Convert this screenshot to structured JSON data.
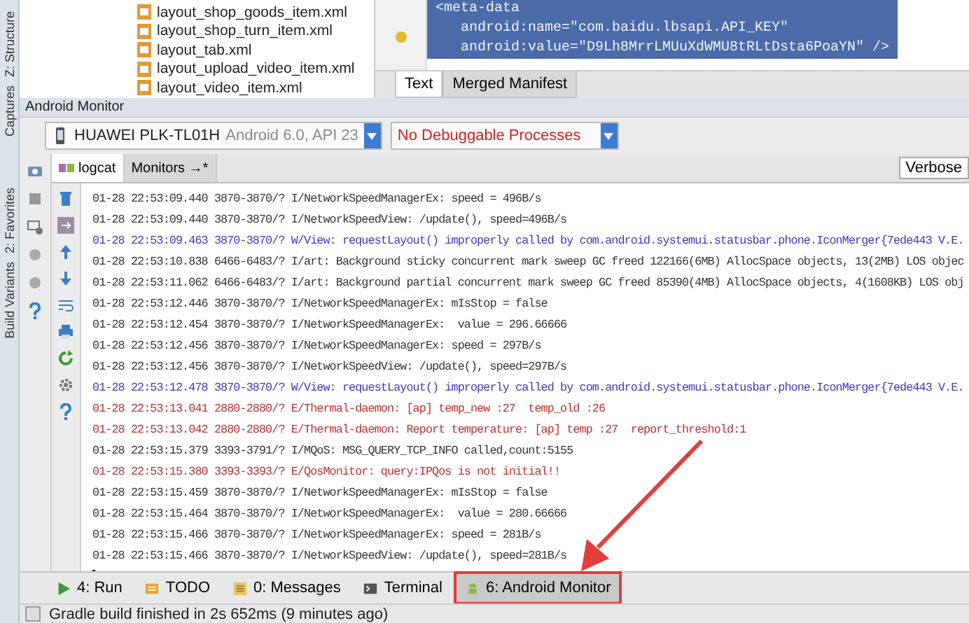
{
  "side_strip": {
    "labels": [
      "Z: Structure",
      "Captures",
      "2: Favorites",
      "Build Variants"
    ]
  },
  "project_tree": {
    "files": [
      "layout_shop_goods_item.xml",
      "layout_shop_turn_item.xml",
      "layout_tab.xml",
      "layout_upload_video_item.xml",
      "layout_video_item.xml"
    ]
  },
  "editor": {
    "lines": [
      {
        "text": "<meta-data",
        "selected": true
      },
      {
        "text": "android:name=\"com.baidu.lbsapi.API_KEY\"",
        "selected": true
      },
      {
        "text": "android:value=\"D9Lh8MrrLMUuXdWMU8tRLtDsta6PoaYN\" />",
        "selected": true
      }
    ],
    "tabs": [
      {
        "label": "Text",
        "selected": true
      },
      {
        "label": "Merged Manifest",
        "selected": false
      }
    ]
  },
  "monitor": {
    "title": "Android Monitor",
    "device": {
      "name": "HUAWEI PLK-TL01H",
      "detail": "Android 6.0, API 23"
    },
    "process": "No Debuggable Processes",
    "tabs": [
      {
        "label": "logcat",
        "selected": true
      },
      {
        "label": "Monitors →*",
        "selected": false
      }
    ],
    "log_level": "Verbose",
    "log": [
      {
        "kind": "I",
        "text": "01-28 22:53:09.440 3870-3870/? I/NetworkSpeedManagerEx: speed = 496B/s"
      },
      {
        "kind": "I",
        "text": "01-28 22:53:09.440 3870-3870/? I/NetworkSpeedView: /update(), speed=496B/s"
      },
      {
        "kind": "W",
        "text": "01-28 22:53:09.463 3870-3870/? W/View: requestLayout() improperly called by com.android.systemui.statusbar.phone.IconMerger{7ede443 V.E."
      },
      {
        "kind": "I",
        "text": "01-28 22:53:10.838 6466-6483/? I/art: Background sticky concurrent mark sweep GC freed 122166(6MB) AllocSpace objects, 13(2MB) LOS objec"
      },
      {
        "kind": "I",
        "text": "01-28 22:53:11.062 6466-6483/? I/art: Background partial concurrent mark sweep GC freed 85390(4MB) AllocSpace objects, 4(1608KB) LOS obj"
      },
      {
        "kind": "I",
        "text": "01-28 22:53:12.446 3870-3870/? I/NetworkSpeedManagerEx: mIsStop = false"
      },
      {
        "kind": "I",
        "text": "01-28 22:53:12.454 3870-3870/? I/NetworkSpeedManagerEx:  value = 296.66666"
      },
      {
        "kind": "I",
        "text": "01-28 22:53:12.456 3870-3870/? I/NetworkSpeedManagerEx: speed = 297B/s"
      },
      {
        "kind": "I",
        "text": "01-28 22:53:12.456 3870-3870/? I/NetworkSpeedView: /update(), speed=297B/s"
      },
      {
        "kind": "W",
        "text": "01-28 22:53:12.478 3870-3870/? W/View: requestLayout() improperly called by com.android.systemui.statusbar.phone.IconMerger{7ede443 V.E."
      },
      {
        "kind": "E",
        "text": "01-28 22:53:13.041 2880-2880/? E/Thermal-daemon: [ap] temp_new :27  temp_old :26"
      },
      {
        "kind": "E",
        "text": "01-28 22:53:13.042 2880-2880/? E/Thermal-daemon: Report temperature: [ap] temp :27  report_threshold:1"
      },
      {
        "kind": "I",
        "text": "01-28 22:53:15.379 3393-3791/? I/MQoS: MSG_QUERY_TCP_INFO called,count:5155"
      },
      {
        "kind": "E",
        "text": "01-28 22:53:15.380 3393-3393/? E/QosMonitor: query:IPQos is not initial!!"
      },
      {
        "kind": "I",
        "text": "01-28 22:53:15.459 3870-3870/? I/NetworkSpeedManagerEx: mIsStop = false"
      },
      {
        "kind": "I",
        "text": "01-28 22:53:15.464 3870-3870/? I/NetworkSpeedManagerEx:  value = 280.66666"
      },
      {
        "kind": "I",
        "text": "01-28 22:53:15.466 3870-3870/? I/NetworkSpeedManagerEx: speed = 281B/s"
      },
      {
        "kind": "I",
        "text": "01-28 22:53:15.466 3870-3870/? I/NetworkSpeedView: /update(), speed=281B/s"
      }
    ]
  },
  "tool_windows": [
    {
      "label": "4: Run",
      "kind": "run",
      "selected": false
    },
    {
      "label": "TODO",
      "kind": "todo",
      "selected": false
    },
    {
      "label": "0: Messages",
      "kind": "messages",
      "selected": false
    },
    {
      "label": "Terminal",
      "kind": "terminal",
      "selected": false
    },
    {
      "label": "6: Android Monitor",
      "kind": "monitor",
      "selected": true
    }
  ],
  "status_bar": "Gradle build finished in 2s 652ms (9 minutes ago)"
}
